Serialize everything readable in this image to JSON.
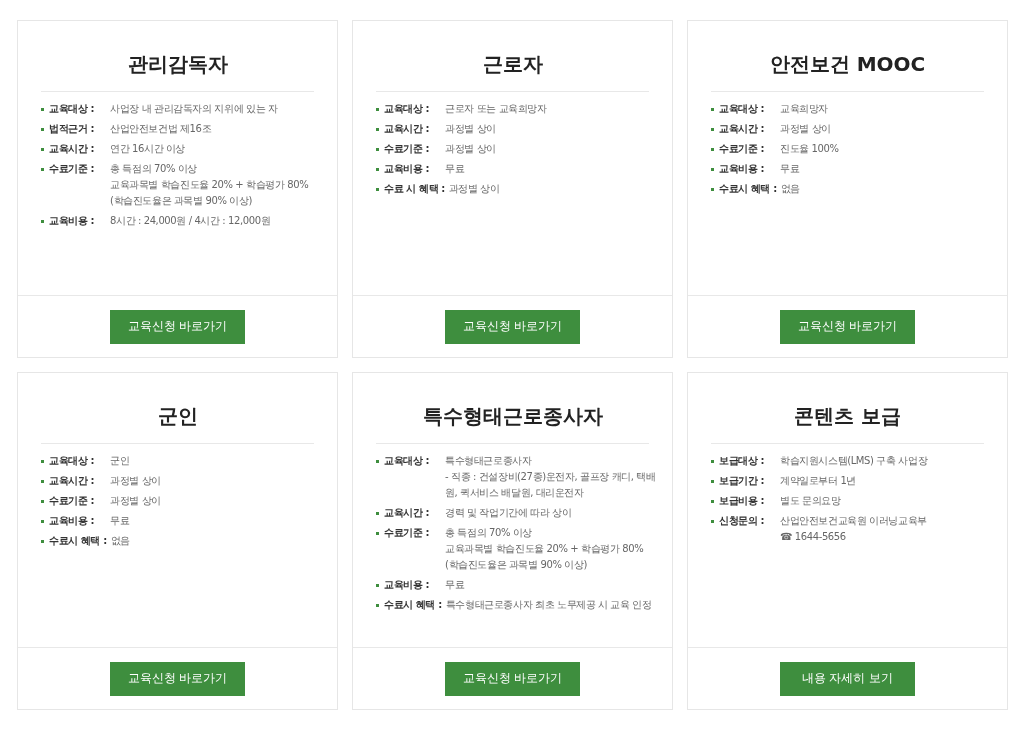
{
  "cards": [
    {
      "title": "관리감독자",
      "items": [
        {
          "label": "교육대상 :",
          "lines": [
            "사업장 내 관리감독자의 지위에 있는 자"
          ]
        },
        {
          "label": "법적근거 :",
          "lines": [
            "산업안전보건법 제16조"
          ]
        },
        {
          "label": "교육시간 :",
          "lines": [
            "연간 16시간 이상"
          ]
        },
        {
          "label": "수료기준 :",
          "lines": [
            "총 득점의 70% 이상",
            "교육과목별 학습진도율 20% + 학습평가 80%",
            "(학습진도율은 과목별 90% 이상)"
          ]
        },
        {
          "label": "교육비용 :",
          "lines": [
            "8시간 : 24,000원 / 4시간 : 12,000원"
          ]
        }
      ],
      "button": "교육신청 바로가기"
    },
    {
      "title": "근로자",
      "items": [
        {
          "label": "교육대상 :",
          "lines": [
            "근로자 또는 교육희망자"
          ]
        },
        {
          "label": "교육시간 :",
          "lines": [
            "과정별 상이"
          ]
        },
        {
          "label": "수료기준 :",
          "lines": [
            "과정별 상이"
          ]
        },
        {
          "label": "교육비용 :",
          "lines": [
            "무료"
          ]
        },
        {
          "label": "수료 시 혜택 :",
          "lines": [
            "과정별 상이"
          ]
        }
      ],
      "button": "교육신청 바로가기"
    },
    {
      "title": "안전보건 MOOC",
      "items": [
        {
          "label": "교육대상 :",
          "lines": [
            "교육희망자"
          ]
        },
        {
          "label": "교육시간 :",
          "lines": [
            "과정별 상이"
          ]
        },
        {
          "label": "수료기준 :",
          "lines": [
            "진도율 100%"
          ]
        },
        {
          "label": "교육비용 :",
          "lines": [
            "무료"
          ]
        },
        {
          "label": "수료시 혜택 :",
          "lines": [
            "없음"
          ]
        }
      ],
      "button": "교육신청 바로가기"
    },
    {
      "title": "군인",
      "items": [
        {
          "label": "교육대상 :",
          "lines": [
            "군인"
          ]
        },
        {
          "label": "교육시간 :",
          "lines": [
            "과정별 상이"
          ]
        },
        {
          "label": "수료기준 :",
          "lines": [
            "과정별 상이"
          ]
        },
        {
          "label": "교육비용 :",
          "lines": [
            "무료"
          ]
        },
        {
          "label": "수료시 혜택 :",
          "lines": [
            "없음"
          ]
        }
      ],
      "button": "교육신청 바로가기"
    },
    {
      "title": "특수형태근로종사자",
      "items": [
        {
          "label": "교육대상 :",
          "lines": [
            "특수형태근로종사자",
            "- 직종 : 건설장비(27종)운전자, 골프장 캐디, 택배",
            "원, 퀵서비스 배달원, 대리운전자"
          ]
        },
        {
          "label": "교육시간 :",
          "lines": [
            "경력 및 작업기간에 따라 상이"
          ]
        },
        {
          "label": "수료기준 :",
          "lines": [
            "총 득점의 70% 이상",
            "교육과목별 학습진도율 20% + 학습평가 80%",
            "(학습진도율은 과목별 90% 이상)"
          ]
        },
        {
          "label": "교육비용 :",
          "lines": [
            "무료"
          ]
        },
        {
          "label": "수료시 혜택 :",
          "lines": [
            "특수형태근로종사자 최초 노무제공 시 교육 인정"
          ]
        }
      ],
      "button": "교육신청 바로가기"
    },
    {
      "title": "콘텐츠 보급",
      "items": [
        {
          "label": "보급대상 :",
          "lines": [
            "학습지원시스템(LMS) 구축 사업장"
          ]
        },
        {
          "label": "보급기간 :",
          "lines": [
            "계약일로부터 1년"
          ]
        },
        {
          "label": "보급비용 :",
          "lines": [
            "별도 문의요망"
          ]
        },
        {
          "label": "신청문의 :",
          "lines": [
            "산업안전보건교육원 이러닝교육부",
            "☎ 1644-5656"
          ]
        }
      ],
      "button": "내용 자세히 보기"
    }
  ]
}
